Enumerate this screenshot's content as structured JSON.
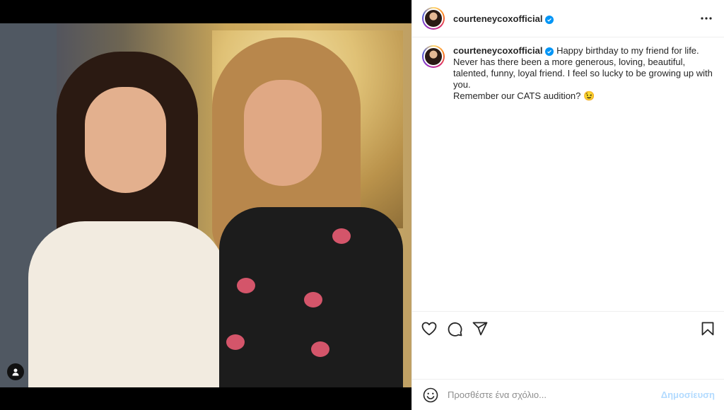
{
  "post": {
    "username": "courteneycoxofficial",
    "verified": true,
    "caption_lines": [
      "Happy birthday to my friend for life.",
      "Never has there been a more generous, loving, beautiful,",
      "talented, funny, loyal friend. I feel so lucky to be growing up with",
      "you.",
      "Remember our CATS audition? 😉"
    ]
  },
  "icons": {
    "more": "more-options-icon",
    "like": "heart-icon",
    "comment": "comment-icon",
    "share": "share-icon",
    "save": "bookmark-icon",
    "emoji": "emoji-icon",
    "tag": "user-tag-icon",
    "verified": "verified-badge-icon"
  },
  "comment": {
    "placeholder": "Προσθέστε ένα σχόλιο...",
    "post_label": "Δημοσίευση"
  },
  "colors": {
    "verified": "#0095f6",
    "post_disabled": "#b3dbff",
    "border": "#efefef"
  }
}
